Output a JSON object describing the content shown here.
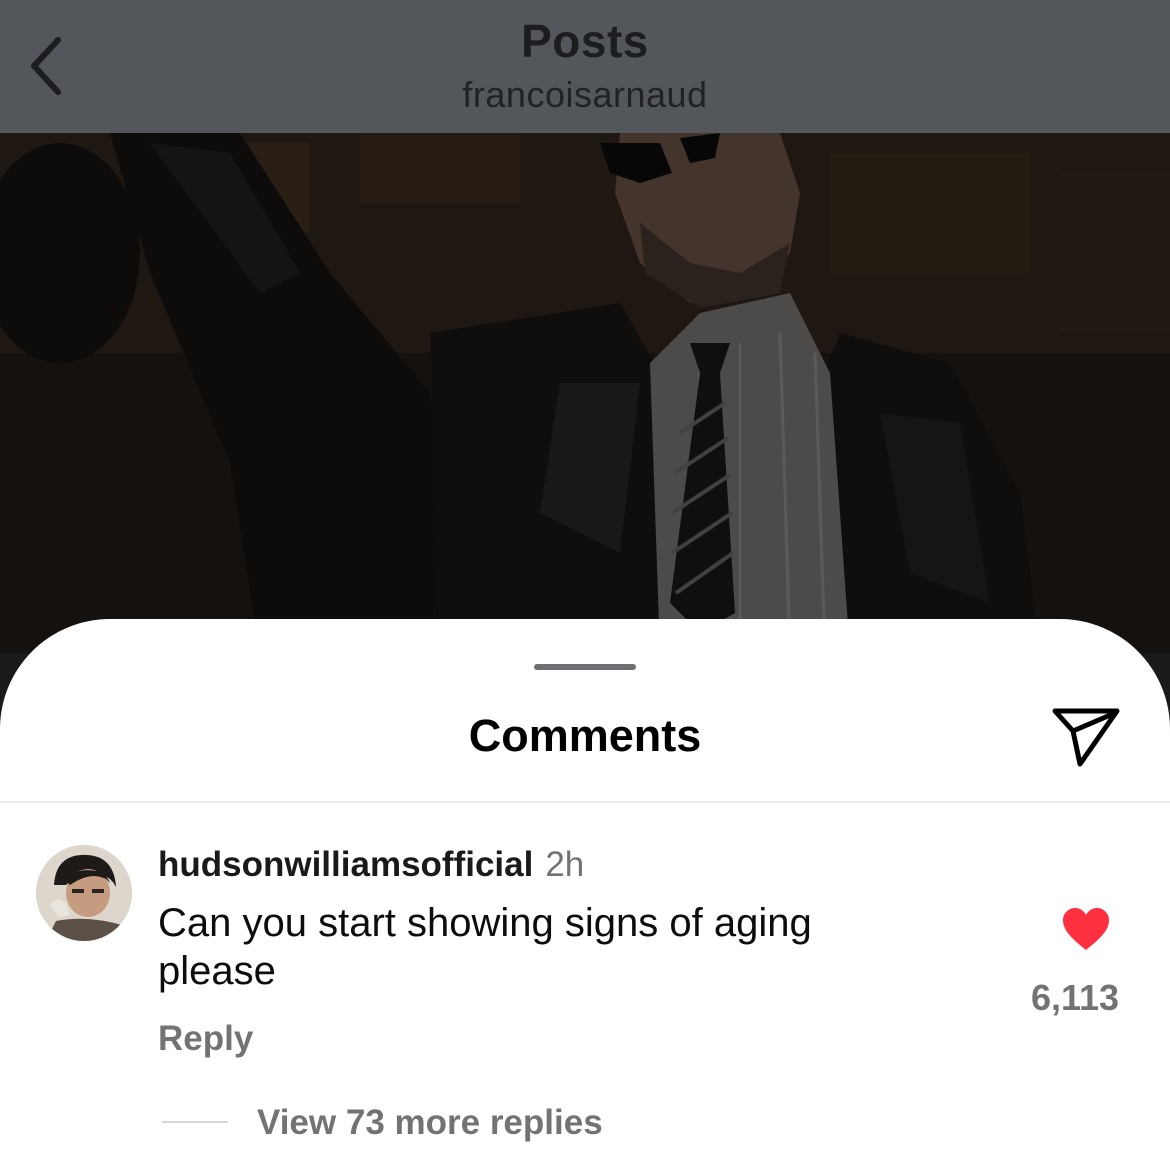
{
  "header": {
    "title": "Posts",
    "subtitle": "francoisarnaud"
  },
  "comments_sheet": {
    "title": "Comments"
  },
  "comment": {
    "username": "hudsonwilliamsofficial",
    "time": "2h",
    "text": "Can you start showing signs of aging please",
    "reply_label": "Reply",
    "like_count": "6,113",
    "view_replies_label": "View 73 more replies"
  },
  "icons": {
    "back": "chevron-left-icon",
    "share": "paper-plane-icon",
    "like": "heart-filled-icon"
  },
  "colors": {
    "like_red": "#ff3040",
    "header_dim": "#53575c",
    "muted_text": "#737373"
  }
}
